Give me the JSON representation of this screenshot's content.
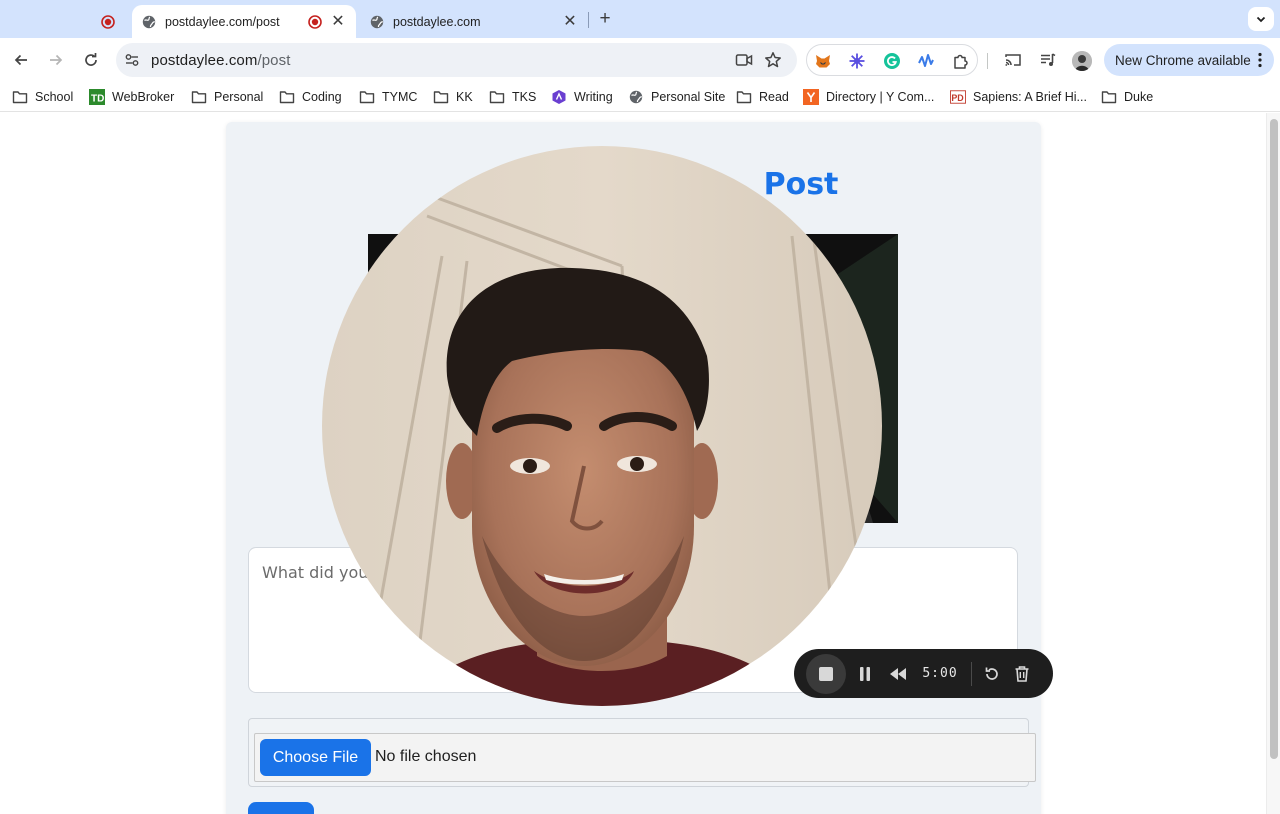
{
  "browser": {
    "tabs": [
      {
        "label": "postdaylee.com/post",
        "active": true,
        "recording": true
      },
      {
        "label": "postdaylee.com",
        "active": false
      }
    ],
    "address_bar": {
      "host": "postdaylee.com",
      "path": "/post"
    },
    "update_button": "New Chrome available",
    "bookmarks": [
      {
        "label": "School",
        "icon": "folder-icon"
      },
      {
        "label": "WebBroker",
        "icon": "td-logo-icon"
      },
      {
        "label": "Personal",
        "icon": "folder-icon"
      },
      {
        "label": "Coding",
        "icon": "folder-icon"
      },
      {
        "label": "TYMC",
        "icon": "folder-icon"
      },
      {
        "label": "KK",
        "icon": "folder-icon"
      },
      {
        "label": "TKS",
        "icon": "folder-icon"
      },
      {
        "label": "Writing",
        "icon": "writing-logo-icon"
      },
      {
        "label": "Personal Site",
        "icon": "globe-icon"
      },
      {
        "label": "Read",
        "icon": "folder-icon"
      },
      {
        "label": "Directory | Y Com...",
        "icon": "y-combinator-icon"
      },
      {
        "label": "Sapiens: A Brief Hi...",
        "icon": "pd-logo-icon"
      },
      {
        "label": "Duke",
        "icon": "folder-icon"
      }
    ]
  },
  "page": {
    "title_visible_fragment": "Post",
    "textarea_placeholder_visible": "What did you g",
    "file_button": "Choose File",
    "file_status": "No file chosen"
  },
  "recorder": {
    "time": "5:00"
  },
  "colors": {
    "accent": "#1a73e8",
    "tabstrip": "#d3e3fd",
    "recording_red": "#c5221f"
  }
}
